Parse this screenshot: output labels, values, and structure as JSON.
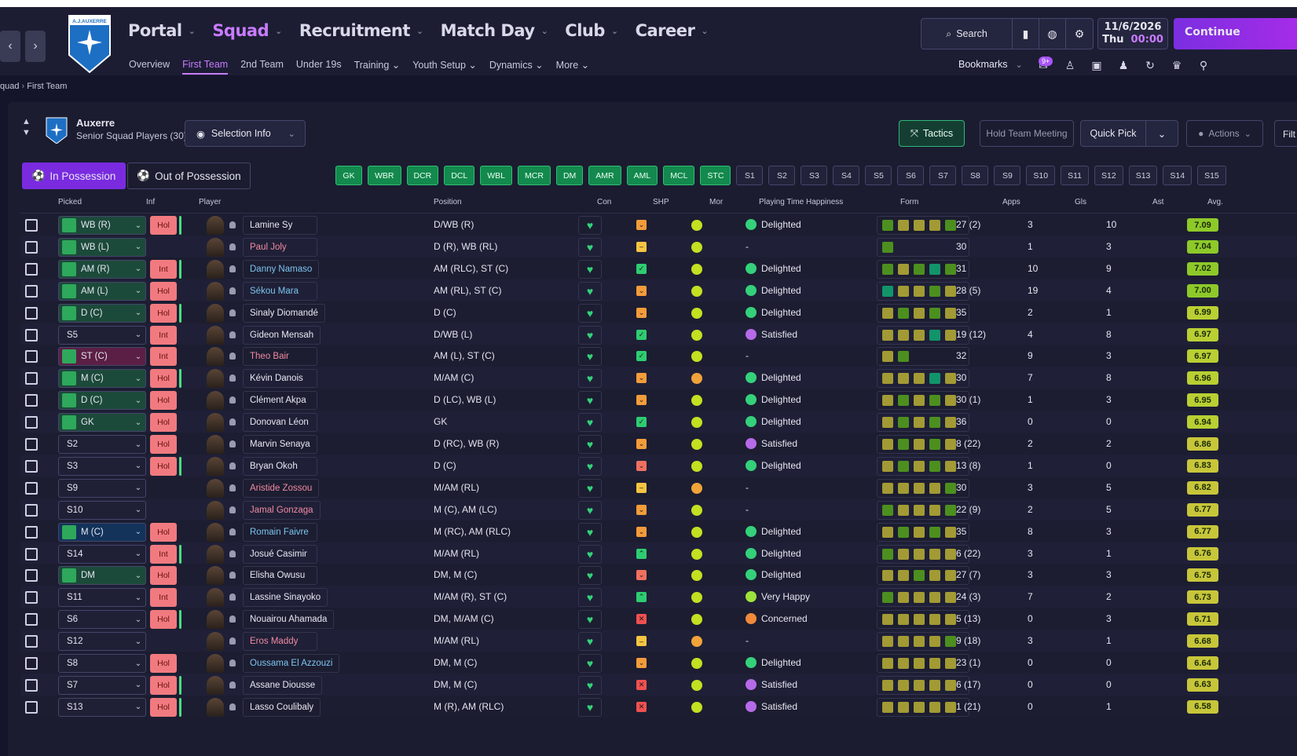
{
  "nav": {
    "back": "‹",
    "forward": "›",
    "main": [
      {
        "label": "Portal"
      },
      {
        "label": "Squad",
        "active": true
      },
      {
        "label": "Recruitment"
      },
      {
        "label": "Match Day"
      },
      {
        "label": "Club"
      },
      {
        "label": "Career"
      }
    ],
    "sub": [
      {
        "label": "Overview"
      },
      {
        "label": "First Team",
        "active": true
      },
      {
        "label": "2nd Team"
      },
      {
        "label": "Under 19s"
      },
      {
        "label": "Training ⌄"
      },
      {
        "label": "Youth Setup ⌄"
      },
      {
        "label": "Dynamics ⌄"
      },
      {
        "label": "More ⌄"
      }
    ],
    "crest_text": "A.J. AUXERRE"
  },
  "toolbar": {
    "search": "Search",
    "date": "11/6/2026",
    "day": "Thu",
    "time": "00:00",
    "continue": "Continue",
    "bookmarks": "Bookmarks",
    "inbox_badge": "9+"
  },
  "breadcrumb": {
    "parent": "quad",
    "current": "First Team"
  },
  "squad": {
    "club": "Auxerre",
    "subtitle": "Senior Squad Players (30)",
    "selection_info": "Selection Info",
    "tactics": "Tactics",
    "meeting": "Hold Team Meeting",
    "quick_pick": "Quick Pick",
    "actions": "Actions",
    "filter": "Filt",
    "in_possession": "In Possession",
    "out_of_possession": "Out of Possession"
  },
  "positions": {
    "selected": [
      "GK",
      "WBR",
      "DCR",
      "DCL",
      "WBL",
      "MCR",
      "DM",
      "AMR",
      "AML",
      "MCL",
      "STC"
    ],
    "subs": [
      "S1",
      "S2",
      "S3",
      "S4",
      "S5",
      "S6",
      "S7",
      "S8",
      "S9",
      "S10",
      "S11",
      "S12",
      "S13",
      "S14",
      "S15"
    ]
  },
  "columns": {
    "picked": "Picked",
    "inf": "Inf",
    "player": "Player",
    "position": "Position",
    "con": "Con",
    "shp": "SHP",
    "mor": "Mor",
    "happiness": "Playing Time Happiness",
    "form": "Form",
    "apps": "Apps",
    "gls": "Gls",
    "ast": "Ast",
    "avg": "Avg."
  },
  "colors": {
    "accent": "#c87bff",
    "form_yellow": "#b8aa3a",
    "form_green": "#3aa532",
    "form_teal": "#17a06a",
    "rating_high": "#9ccf2a",
    "rating_mid": "#c9c83a"
  },
  "players": [
    {
      "picked": "WB (R)",
      "inf": "Hol",
      "bar": true,
      "name": "Lamine Sy",
      "cls": "",
      "pos": "D/WB (R)",
      "shp": "o",
      "mor": "g",
      "happy": "Delighted",
      "form": [
        "g",
        "y",
        "y",
        "y",
        "g"
      ],
      "apps": "27 (2)",
      "gls": "3",
      "ast": "10",
      "avg": "7.09"
    },
    {
      "picked": "WB (L)",
      "inf": "",
      "bar": false,
      "name": "Paul Joly",
      "cls": "red",
      "pos": "D (R), WB (RL)",
      "shp": "m",
      "mor": "g",
      "happy": "-",
      "form": [
        "g"
      ],
      "apps": "30",
      "gls": "1",
      "ast": "3",
      "avg": "7.04"
    },
    {
      "picked": "AM (R)",
      "inf": "Int",
      "bar": true,
      "name": "Danny Namaso",
      "cls": "blue",
      "pos": "AM (RLC), ST (C)",
      "shp": "c",
      "mor": "g",
      "happy": "Delighted",
      "form": [
        "g",
        "y",
        "g",
        "t",
        "g"
      ],
      "apps": "31",
      "gls": "10",
      "ast": "9",
      "avg": "7.02"
    },
    {
      "picked": "AM (L)",
      "inf": "Hol",
      "bar": false,
      "name": "Sékou Mara",
      "cls": "blue",
      "pos": "AM (RL), ST (C)",
      "shp": "o",
      "mor": "g",
      "happy": "Delighted",
      "form": [
        "t",
        "y",
        "y",
        "g",
        "y"
      ],
      "apps": "28 (5)",
      "gls": "19",
      "ast": "4",
      "avg": "7.00"
    },
    {
      "picked": "D (C)",
      "inf": "Hol",
      "bar": true,
      "name": "Sinaly Diomandé",
      "cls": "",
      "pos": "D (C)",
      "shp": "o",
      "mor": "g",
      "happy": "Delighted",
      "form": [
        "y",
        "g",
        "y",
        "g",
        "y"
      ],
      "apps": "35",
      "gls": "2",
      "ast": "1",
      "avg": "6.99"
    },
    {
      "picked": "S5",
      "inf": "Int",
      "bar": false,
      "name": "Gideon Mensah",
      "cls": "",
      "pos": "D/WB (L)",
      "shp": "c",
      "mor": "g",
      "happy": "Satisfied",
      "form": [
        "y",
        "y",
        "y",
        "t",
        "y"
      ],
      "apps": "19 (12)",
      "gls": "4",
      "ast": "8",
      "avg": "6.97"
    },
    {
      "picked": "ST (C)",
      "inf": "Int",
      "bar": false,
      "name": "Theo Bair",
      "cls": "red",
      "pos": "AM (L), ST (C)",
      "shp": "c",
      "mor": "g",
      "happy": "-",
      "form": [
        "y",
        "g"
      ],
      "apps": "32",
      "gls": "9",
      "ast": "3",
      "avg": "6.97"
    },
    {
      "picked": "M (C)",
      "inf": "Hol",
      "bar": true,
      "name": "Kévin Danois",
      "cls": "",
      "pos": "M/AM (C)",
      "shp": "o",
      "mor": "o",
      "happy": "Delighted",
      "form": [
        "y",
        "y",
        "y",
        "t",
        "y"
      ],
      "apps": "30",
      "gls": "7",
      "ast": "8",
      "avg": "6.96"
    },
    {
      "picked": "D (C)",
      "inf": "Hol",
      "bar": false,
      "name": "Clément Akpa",
      "cls": "",
      "pos": "D (LC), WB (L)",
      "shp": "o",
      "mor": "g",
      "happy": "Delighted",
      "form": [
        "y",
        "g",
        "y",
        "g",
        "y"
      ],
      "apps": "30 (1)",
      "gls": "1",
      "ast": "3",
      "avg": "6.95"
    },
    {
      "picked": "GK",
      "inf": "Hol",
      "bar": false,
      "name": "Donovan Léon",
      "cls": "",
      "pos": "GK",
      "shp": "c",
      "mor": "g",
      "happy": "Delighted",
      "form": [
        "y",
        "g",
        "y",
        "g",
        "y"
      ],
      "apps": "36",
      "gls": "0",
      "ast": "0",
      "avg": "6.94"
    },
    {
      "picked": "S2",
      "inf": "Hol",
      "bar": false,
      "name": "Marvin Senaya",
      "cls": "",
      "pos": "D (RC), WB (R)",
      "shp": "o",
      "mor": "g",
      "happy": "Satisfied",
      "form": [
        "y",
        "g",
        "y",
        "g",
        "y"
      ],
      "apps": "8 (22)",
      "gls": "2",
      "ast": "2",
      "avg": "6.86"
    },
    {
      "picked": "S3",
      "inf": "Hol",
      "bar": true,
      "name": "Bryan Okoh",
      "cls": "",
      "pos": "D (C)",
      "shp": "d",
      "mor": "g",
      "happy": "Delighted",
      "form": [
        "y",
        "g",
        "y",
        "g",
        "y"
      ],
      "apps": "13 (8)",
      "gls": "1",
      "ast": "0",
      "avg": "6.83"
    },
    {
      "picked": "S9",
      "inf": "",
      "bar": false,
      "name": "Aristide Zossou",
      "cls": "red",
      "pos": "M/AM (RL)",
      "shp": "m",
      "mor": "o",
      "happy": "-",
      "form": [
        "y",
        "y",
        "y",
        "y",
        "g"
      ],
      "apps": "30",
      "gls": "3",
      "ast": "5",
      "avg": "6.82"
    },
    {
      "picked": "S10",
      "inf": "",
      "bar": false,
      "name": "Jamal Gonzaga",
      "cls": "red",
      "pos": "M (C), AM (LC)",
      "shp": "o",
      "mor": "g",
      "happy": "-",
      "form": [
        "g",
        "y",
        "y",
        "y",
        "g"
      ],
      "apps": "22 (9)",
      "gls": "2",
      "ast": "5",
      "avg": "6.77"
    },
    {
      "picked": "M (C)",
      "inf": "Hol",
      "bar": false,
      "name": "Romain Faivre",
      "cls": "blue",
      "pos": "M (RC), AM (RLC)",
      "shp": "o",
      "mor": "g",
      "happy": "Delighted",
      "form": [
        "y",
        "g",
        "y",
        "g",
        "y"
      ],
      "apps": "35",
      "gls": "8",
      "ast": "3",
      "avg": "6.77"
    },
    {
      "picked": "S14",
      "inf": "Int",
      "bar": true,
      "name": "Josué Casimir",
      "cls": "",
      "pos": "M/AM (RL)",
      "shp": "u",
      "mor": "g",
      "happy": "Delighted",
      "form": [
        "g",
        "y",
        "y",
        "y",
        "y"
      ],
      "apps": "6 (22)",
      "gls": "3",
      "ast": "1",
      "avg": "6.76"
    },
    {
      "picked": "DM",
      "inf": "Hol",
      "bar": false,
      "name": "Elisha Owusu",
      "cls": "",
      "pos": "DM, M (C)",
      "shp": "d",
      "mor": "g",
      "happy": "Delighted",
      "form": [
        "y",
        "y",
        "g",
        "y",
        "y"
      ],
      "apps": "27 (7)",
      "gls": "3",
      "ast": "3",
      "avg": "6.75"
    },
    {
      "picked": "S11",
      "inf": "Int",
      "bar": false,
      "name": "Lassine Sinayoko",
      "cls": "",
      "pos": "M/AM (R), ST (C)",
      "shp": "u",
      "mor": "g",
      "happy": "Very Happy",
      "form": [
        "g",
        "y",
        "y",
        "y",
        "y"
      ],
      "apps": "24 (3)",
      "gls": "7",
      "ast": "2",
      "avg": "6.73"
    },
    {
      "picked": "S6",
      "inf": "Hol",
      "bar": true,
      "name": "Nouairou Ahamada",
      "cls": "",
      "pos": "DM, M/AM (C)",
      "shp": "x",
      "mor": "g",
      "happy": "Concerned",
      "form": [
        "y",
        "y",
        "y",
        "y",
        "y"
      ],
      "apps": "5 (13)",
      "gls": "0",
      "ast": "3",
      "avg": "6.71"
    },
    {
      "picked": "S12",
      "inf": "",
      "bar": false,
      "name": "Eros Maddy",
      "cls": "red",
      "pos": "M/AM (RL)",
      "shp": "m",
      "mor": "o",
      "happy": "-",
      "form": [
        "y",
        "y",
        "y",
        "y",
        "g"
      ],
      "apps": "9 (18)",
      "gls": "3",
      "ast": "1",
      "avg": "6.68"
    },
    {
      "picked": "S8",
      "inf": "Hol",
      "bar": false,
      "name": "Oussama El Azzouzi",
      "cls": "blue",
      "pos": "DM, M (C)",
      "shp": "o",
      "mor": "g",
      "happy": "Delighted",
      "form": [
        "y",
        "y",
        "y",
        "y",
        "y"
      ],
      "apps": "23 (1)",
      "gls": "0",
      "ast": "0",
      "avg": "6.64"
    },
    {
      "picked": "S7",
      "inf": "Hol",
      "bar": true,
      "name": "Assane Diousse",
      "cls": "",
      "pos": "DM, M (C)",
      "shp": "x",
      "mor": "g",
      "happy": "Satisfied",
      "form": [
        "y",
        "y",
        "y",
        "y",
        "y"
      ],
      "apps": "6 (17)",
      "gls": "0",
      "ast": "0",
      "avg": "6.63"
    },
    {
      "picked": "S13",
      "inf": "Hol",
      "bar": true,
      "name": "Lasso Coulibaly",
      "cls": "",
      "pos": "M (R), AM (RLC)",
      "shp": "x",
      "mor": "g",
      "happy": "Satisfied",
      "form": [
        "y",
        "y",
        "y",
        "y",
        "y"
      ],
      "apps": "1 (21)",
      "gls": "0",
      "ast": "1",
      "avg": "6.58"
    }
  ]
}
